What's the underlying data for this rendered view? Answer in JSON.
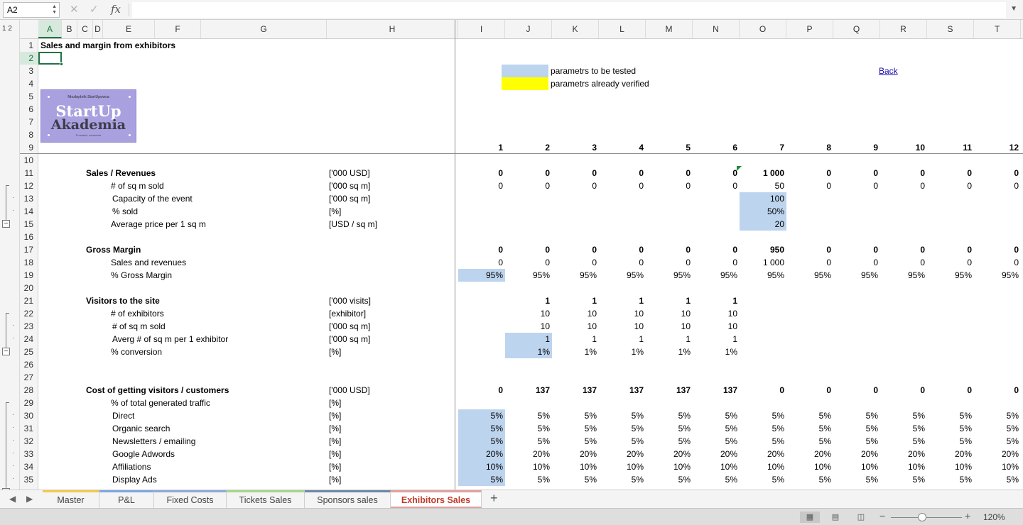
{
  "formula_bar": {
    "name_box": "A2",
    "cancel_glyph": "✕",
    "enter_glyph": "✓",
    "fx_label": "fx",
    "formula": ""
  },
  "outline_levels": "1 2",
  "columns": [
    "A",
    "B",
    "C",
    "D",
    "E",
    "F",
    "G",
    "H",
    "I",
    "J",
    "K",
    "L",
    "M",
    "N",
    "O",
    "P",
    "Q",
    "R",
    "S",
    "T"
  ],
  "active_column": "A",
  "active_row": 2,
  "rows": [
    1,
    2,
    3,
    4,
    5,
    6,
    7,
    8,
    9,
    10,
    11,
    12,
    13,
    14,
    15,
    16,
    17,
    18,
    19,
    20,
    21,
    22,
    23,
    24,
    25,
    26,
    27,
    28,
    29,
    30,
    31,
    32,
    33,
    34,
    35
  ],
  "sheet": {
    "title": "Sales and margin from exhibitors",
    "legend": {
      "tested": "parametrs to be tested",
      "verified": "parametrs already verified"
    },
    "back_link": "Back",
    "period_numbers": [
      "1",
      "2",
      "3",
      "4",
      "5",
      "6",
      "7",
      "8",
      "9",
      "10",
      "11",
      "12"
    ]
  },
  "logo": {
    "top_text": "Niezbędnik StartUpowca",
    "line1": "StartUp",
    "line2": "Akademia",
    "bottom_text": "Prowadzi: zarazwde"
  },
  "table_rows": [
    {
      "row": 11,
      "indent": 0,
      "bold": true,
      "label": "Sales / Revenues",
      "unit": "['000 USD]",
      "values": [
        "0",
        "0",
        "0",
        "0",
        "0",
        "0",
        "1 000",
        "0",
        "0",
        "0",
        "0",
        "0"
      ]
    },
    {
      "row": 12,
      "indent": 1,
      "bold": false,
      "label": "# of sq m sold",
      "unit": "['000 sq m]",
      "values": [
        "0",
        "0",
        "0",
        "0",
        "0",
        "0",
        "50",
        "0",
        "0",
        "0",
        "0",
        "0"
      ]
    },
    {
      "row": 13,
      "indent": 2,
      "bold": false,
      "label": "Capacity of the event",
      "unit": "['000 sq m]",
      "values": [
        "",
        "",
        "",
        "",
        "",
        "",
        "100",
        "",
        "",
        "",
        "",
        ""
      ],
      "fills": {
        "6": "blue"
      }
    },
    {
      "row": 14,
      "indent": 2,
      "bold": false,
      "label": "% sold",
      "unit": "[%]",
      "values": [
        "",
        "",
        "",
        "",
        "",
        "",
        "50%",
        "",
        "",
        "",
        "",
        ""
      ],
      "fills": {
        "6": "blue"
      }
    },
    {
      "row": 15,
      "indent": 1,
      "bold": false,
      "label": "Average price per 1 sq m",
      "unit": "[USD / sq m]",
      "values": [
        "",
        "",
        "",
        "",
        "",
        "",
        "20",
        "",
        "",
        "",
        "",
        ""
      ],
      "fills": {
        "6": "blue"
      }
    },
    {
      "row": 17,
      "indent": 0,
      "bold": true,
      "label": "Gross Margin",
      "unit": "",
      "values": [
        "0",
        "0",
        "0",
        "0",
        "0",
        "0",
        "950",
        "0",
        "0",
        "0",
        "0",
        "0"
      ]
    },
    {
      "row": 18,
      "indent": 1,
      "bold": false,
      "label": "Sales and revenues",
      "unit": "",
      "values": [
        "0",
        "0",
        "0",
        "0",
        "0",
        "0",
        "1 000",
        "0",
        "0",
        "0",
        "0",
        "0"
      ]
    },
    {
      "row": 19,
      "indent": 1,
      "bold": false,
      "label": "% Gross Margin",
      "unit": "",
      "values": [
        "95%",
        "95%",
        "95%",
        "95%",
        "95%",
        "95%",
        "95%",
        "95%",
        "95%",
        "95%",
        "95%",
        "95%"
      ],
      "fills": {
        "0": "blue"
      }
    },
    {
      "row": 21,
      "indent": 0,
      "bold": true,
      "label": "Visitors to the site",
      "unit": "['000 visits]",
      "values": [
        "",
        "1",
        "1",
        "1",
        "1",
        "1",
        "",
        "",
        "",
        "",
        "",
        ""
      ]
    },
    {
      "row": 22,
      "indent": 1,
      "bold": false,
      "label": "# of exhibitors",
      "unit": "[exhibitor]",
      "values": [
        "",
        "10",
        "10",
        "10",
        "10",
        "10",
        "",
        "",
        "",
        "",
        "",
        ""
      ]
    },
    {
      "row": 23,
      "indent": 2,
      "bold": false,
      "label": "# of sq m sold",
      "unit": "['000 sq m]",
      "values": [
        "",
        "10",
        "10",
        "10",
        "10",
        "10",
        "",
        "",
        "",
        "",
        "",
        ""
      ]
    },
    {
      "row": 24,
      "indent": 2,
      "bold": false,
      "label": "Averg # of sq m per 1 exhibitor",
      "unit": "['000 sq m]",
      "values": [
        "",
        "1",
        "1",
        "1",
        "1",
        "1",
        "",
        "",
        "",
        "",
        "",
        ""
      ],
      "fills": {
        "1": "blue"
      }
    },
    {
      "row": 25,
      "indent": 1,
      "bold": false,
      "label": "% conversion",
      "unit": "[%]",
      "values": [
        "",
        "1%",
        "1%",
        "1%",
        "1%",
        "1%",
        "",
        "",
        "",
        "",
        "",
        ""
      ],
      "fills": {
        "1": "blue"
      }
    },
    {
      "row": 28,
      "indent": 0,
      "bold": true,
      "label": "Cost of getting visitors / customers",
      "unit": "['000 USD]",
      "values": [
        "0",
        "137",
        "137",
        "137",
        "137",
        "137",
        "0",
        "0",
        "0",
        "0",
        "0",
        "0"
      ]
    },
    {
      "row": 29,
      "indent": 1,
      "bold": false,
      "label": "% of total generated traffic",
      "unit": "[%]",
      "values": [
        "",
        "",
        "",
        "",
        "",
        "",
        "",
        "",
        "",
        "",
        "",
        ""
      ]
    },
    {
      "row": 30,
      "indent": 2,
      "bold": false,
      "label": "Direct",
      "unit": "[%]",
      "values": [
        "5%",
        "5%",
        "5%",
        "5%",
        "5%",
        "5%",
        "5%",
        "5%",
        "5%",
        "5%",
        "5%",
        "5%"
      ],
      "fills": {
        "0": "blue"
      }
    },
    {
      "row": 31,
      "indent": 2,
      "bold": false,
      "label": "Organic search",
      "unit": "[%]",
      "values": [
        "5%",
        "5%",
        "5%",
        "5%",
        "5%",
        "5%",
        "5%",
        "5%",
        "5%",
        "5%",
        "5%",
        "5%"
      ],
      "fills": {
        "0": "blue"
      }
    },
    {
      "row": 32,
      "indent": 2,
      "bold": false,
      "label": "Newsletters / emailing",
      "unit": "[%]",
      "values": [
        "5%",
        "5%",
        "5%",
        "5%",
        "5%",
        "5%",
        "5%",
        "5%",
        "5%",
        "5%",
        "5%",
        "5%"
      ],
      "fills": {
        "0": "blue"
      }
    },
    {
      "row": 33,
      "indent": 2,
      "bold": false,
      "label": "Google Adwords",
      "unit": "[%]",
      "values": [
        "20%",
        "20%",
        "20%",
        "20%",
        "20%",
        "20%",
        "20%",
        "20%",
        "20%",
        "20%",
        "20%",
        "20%"
      ],
      "fills": {
        "0": "blue"
      }
    },
    {
      "row": 34,
      "indent": 2,
      "bold": false,
      "label": "Affiliations",
      "unit": "[%]",
      "values": [
        "10%",
        "10%",
        "10%",
        "10%",
        "10%",
        "10%",
        "10%",
        "10%",
        "10%",
        "10%",
        "10%",
        "10%"
      ],
      "fills": {
        "0": "blue"
      }
    },
    {
      "row": 35,
      "indent": 2,
      "bold": false,
      "label": "Display Ads",
      "unit": "[%]",
      "values": [
        "5%",
        "5%",
        "5%",
        "5%",
        "5%",
        "5%",
        "5%",
        "5%",
        "5%",
        "5%",
        "5%",
        "5%"
      ],
      "fills": {
        "0": "blue"
      }
    }
  ],
  "sheet_tabs": [
    {
      "label": "Master",
      "color": "#f2c94c",
      "active": false
    },
    {
      "label": "P&L",
      "color": "#7ea6e0",
      "active": false
    },
    {
      "label": "Fixed Costs",
      "color": "#8fa8d8",
      "active": false
    },
    {
      "label": "Tickets Sales",
      "color": "#a6d68a",
      "active": false
    },
    {
      "label": "Sponsors sales",
      "color": "#6f86a8",
      "active": false
    },
    {
      "label": "Exhibitors Sales",
      "color": "#e3a0a0",
      "active": true
    }
  ],
  "add_sheet_glyph": "+",
  "status_bar": {
    "zoom_level": "120%",
    "zoom_fraction": 0.44
  },
  "colors": {
    "accent": "#217346",
    "fill_blue": "#bdd4ee",
    "fill_yellow": "#ffff00",
    "link": "#1a0dab"
  }
}
